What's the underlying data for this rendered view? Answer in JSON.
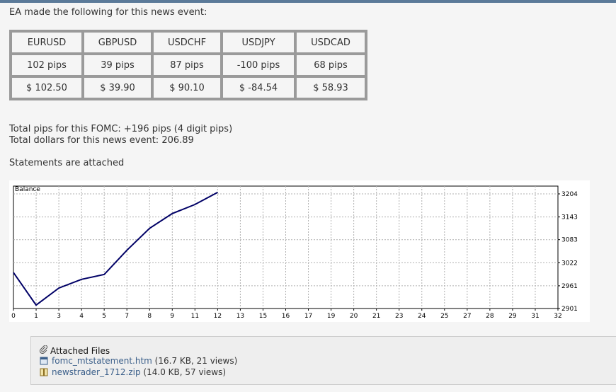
{
  "intro": "EA made the following for this news event:",
  "table": {
    "headers": [
      "EURUSD",
      "GBPUSD",
      "USDCHF",
      "USDJPY",
      "USDCAD"
    ],
    "pips": [
      "102 pips",
      "39 pips",
      "87 pips",
      "-100 pips",
      "68 pips"
    ],
    "dollars": [
      "$ 102.50",
      "$ 39.90",
      "$ 90.10",
      "$ -84.54",
      "$ 58.93"
    ]
  },
  "totals": {
    "pips_line": "Total pips for this FOMC: +196 pips (4 digit pips)",
    "dollars_line": "Total dollars for this news event: 206.89"
  },
  "statements_note": "Statements are attached",
  "chart_data": {
    "type": "line",
    "title": "Balance",
    "xlabel": "",
    "ylabel": "",
    "x_ticks": [
      "0",
      "1",
      "3",
      "4",
      "5",
      "7",
      "8",
      "9",
      "11",
      "12",
      "13",
      "15",
      "16",
      "17",
      "19",
      "20",
      "21",
      "23",
      "24",
      "25",
      "27",
      "28",
      "29",
      "31",
      "32"
    ],
    "y_ticks": [
      2901,
      2961,
      3022,
      3083,
      3143,
      3204
    ],
    "ylim": [
      2901,
      3204
    ],
    "grid": true,
    "line_color": "#000066",
    "series": [
      {
        "x": [
          0,
          1,
          2,
          3,
          4,
          5,
          6,
          7,
          8,
          9
        ],
        "y": [
          2996,
          2910,
          2955,
          2978,
          2991,
          3055,
          3113,
          3152,
          3176,
          3208
        ]
      }
    ]
  },
  "attachments": {
    "title": "Attached Files",
    "files": [
      {
        "name": "fomc_mtstatement.htm",
        "meta": "(16.7 KB, 21 views)",
        "icon": "html-file-icon"
      },
      {
        "name": "newstrader_1712.zip",
        "meta": "(14.0 KB, 57 views)",
        "icon": "zip-file-icon"
      }
    ]
  }
}
